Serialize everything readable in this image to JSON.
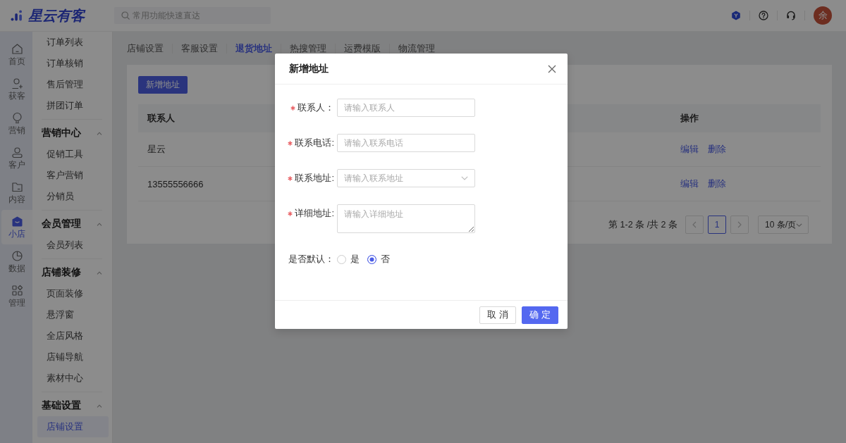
{
  "top_bar": {
    "logo": "星云有客",
    "search": {
      "placeholder": "常用功能快速直达"
    },
    "avatar": "余"
  },
  "rail": {
    "items": [
      {
        "label": "首页",
        "selected": false
      },
      {
        "label": "获客",
        "selected": false
      },
      {
        "label": "营销",
        "selected": false
      },
      {
        "label": "客户",
        "selected": false
      },
      {
        "label": "内容",
        "selected": false
      },
      {
        "label": "小店",
        "selected": true
      },
      {
        "label": "数据",
        "selected": false
      },
      {
        "label": "管理",
        "selected": false
      }
    ]
  },
  "sidebar": {
    "groups": [
      {
        "items": [
          {
            "label": "订单列表",
            "selected": false
          },
          {
            "label": "订单核销",
            "selected": false
          },
          {
            "label": "售后管理",
            "selected": false
          },
          {
            "label": "拼团订单",
            "selected": false
          }
        ]
      },
      {
        "title": "营销中心",
        "expanded": true,
        "items": [
          {
            "label": "促销工具",
            "selected": false
          },
          {
            "label": "客户营销",
            "selected": false
          },
          {
            "label": "分销员",
            "selected": false
          }
        ]
      },
      {
        "title": "会员管理",
        "expanded": true,
        "items": [
          {
            "label": "会员列表",
            "selected": false
          }
        ]
      },
      {
        "title": "店铺装修",
        "expanded": true,
        "items": [
          {
            "label": "页面装修",
            "selected": false
          },
          {
            "label": "悬浮窗",
            "selected": false
          },
          {
            "label": "全店风格",
            "selected": false
          },
          {
            "label": "店铺导航",
            "selected": false
          },
          {
            "label": "素材中心",
            "selected": false
          }
        ]
      },
      {
        "title": "基础设置",
        "expanded": true,
        "items": [
          {
            "label": "店铺设置",
            "selected": true
          }
        ]
      }
    ]
  },
  "tabs": [
    {
      "label": "店铺设置",
      "selected": false
    },
    {
      "label": "客服设置",
      "selected": false
    },
    {
      "label": "退货地址",
      "selected": true
    },
    {
      "label": "热搜管理",
      "selected": false
    },
    {
      "label": "运费模版",
      "selected": false
    },
    {
      "label": "物流管理",
      "selected": false
    }
  ],
  "toolbar": {
    "add_button": "新增地址"
  },
  "table": {
    "columns": [
      "联系人",
      "操作"
    ],
    "rows": [
      {
        "cells": [
          "星云"
        ],
        "actions": [
          "编辑",
          "删除"
        ]
      },
      {
        "cells": [
          "13555556666"
        ],
        "actions": [
          "编辑",
          "删除"
        ]
      }
    ]
  },
  "pagination": {
    "summary": "第 1-2 条 /共 2 条",
    "pages": [
      {
        "label": "1",
        "selected": true
      }
    ],
    "page_size": "10 条/页"
  },
  "dialog": {
    "title": "新增地址",
    "fields": [
      {
        "kind": "input",
        "label": "联系人：",
        "required": true,
        "placeholder": "请输入联系人"
      },
      {
        "kind": "input",
        "label": "联系电话:",
        "required": true,
        "placeholder": "请输入联系电话"
      },
      {
        "kind": "select",
        "label": "联系地址:",
        "required": true,
        "placeholder": "请输入联系地址"
      },
      {
        "kind": "textarea",
        "label": "详细地址:",
        "required": true,
        "placeholder": "请输入详细地址"
      },
      {
        "kind": "radio",
        "label": "是否默认：",
        "required": false,
        "options": [
          {
            "label": "是",
            "selected": false
          },
          {
            "label": "否",
            "selected": true
          }
        ]
      }
    ],
    "buttons": [
      {
        "label": "取 消",
        "kind": "default"
      },
      {
        "label": "确 定",
        "kind": "primary"
      }
    ]
  }
}
